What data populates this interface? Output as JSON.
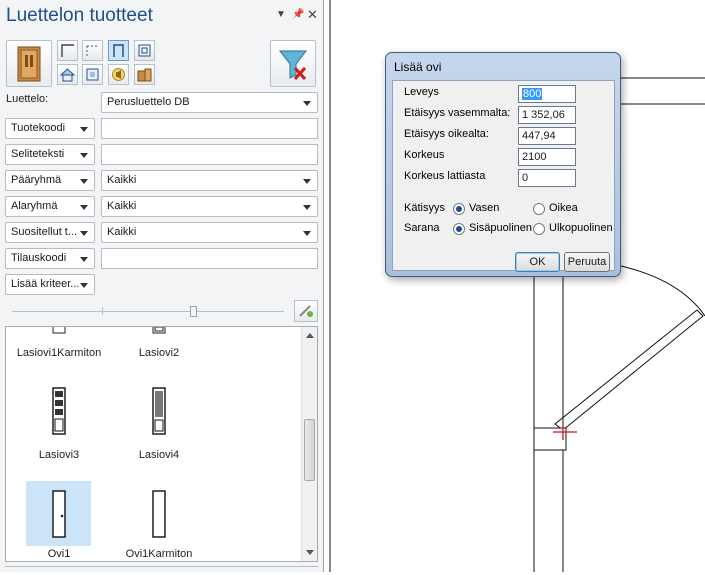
{
  "panel": {
    "title": "Luettelon tuotteet",
    "controls": {
      "dropdown_icon": "chevron-down-icon",
      "pin_icon": "pin-icon",
      "close_icon": "close-icon"
    },
    "filter_button_icon": "filter-clear-icon",
    "catalog_label": "Luettelo:",
    "catalog_value": "Perusluettelo DB",
    "filters": [
      {
        "label": "Tuotekoodi",
        "value": "",
        "kind": "text"
      },
      {
        "label": "Seliteteksti",
        "value": "",
        "kind": "text"
      },
      {
        "label": "Pääryhmä",
        "value": "Kaikki",
        "kind": "combo"
      },
      {
        "label": "Alaryhmä",
        "value": "Kaikki",
        "kind": "combo"
      },
      {
        "label": "Suositellut t...",
        "value": "Kaikki",
        "kind": "combo"
      },
      {
        "label": "Tilauskoodi",
        "value": "",
        "kind": "text"
      }
    ],
    "more_criteria": "Lisää kriteer...",
    "items": [
      {
        "label": "Lasiovi1Karmiton",
        "icon": "door-icon"
      },
      {
        "label": "Lasiovi2",
        "icon": "door-icon"
      },
      {
        "label": "Lasiovi3",
        "icon": "glass-door-icon"
      },
      {
        "label": "Lasiovi4",
        "icon": "glass-door-icon"
      },
      {
        "label": "Ovi1",
        "icon": "door-icon",
        "selected": true
      },
      {
        "label": "Ovi1Karmiton",
        "icon": "door-icon"
      }
    ]
  },
  "dialog": {
    "title": "Lisää ovi",
    "fields": [
      {
        "label": "Leveys",
        "value": "800"
      },
      {
        "label": "Etäisyys vasemmalta:",
        "value": "1 352,06"
      },
      {
        "label": "Etäisyys oikealta:",
        "value": "447,94"
      },
      {
        "label": "Korkeus",
        "value": "2100"
      },
      {
        "label": "Korkeus lattiasta",
        "value": "0"
      }
    ],
    "handedness": {
      "label": "Kätisyys",
      "options": [
        "Vasen",
        "Oikea"
      ],
      "selected": "Vasen"
    },
    "hinge": {
      "label": "Sarana",
      "options": [
        "Sisäpuolinen",
        "Ulkopuolinen"
      ],
      "selected": "Sisäpuolinen"
    },
    "ok": "OK",
    "cancel": "Peruuta"
  },
  "colors": {
    "title": "#1e4e8c",
    "selection": "#cce4f7",
    "crosshair": "#d01010"
  }
}
